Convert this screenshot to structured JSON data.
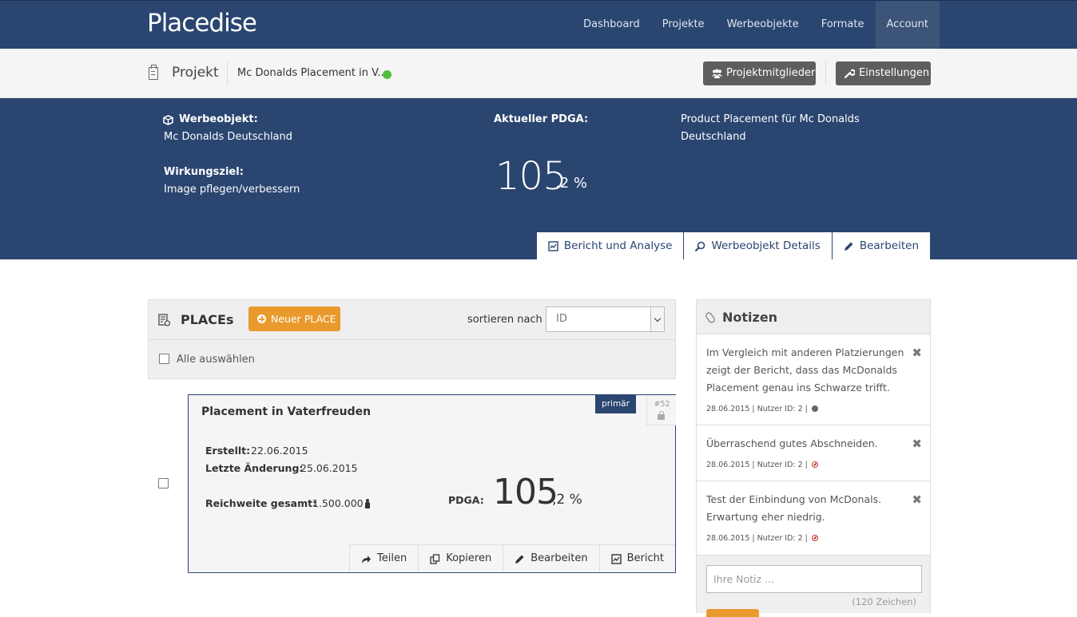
{
  "brand": "Placedise",
  "nav": {
    "items": [
      {
        "label": "Dashboard",
        "name": "nav-dashboard"
      },
      {
        "label": "Projekte",
        "name": "nav-projekte"
      },
      {
        "label": "Werbeobjekte",
        "name": "nav-werbeobjekte"
      },
      {
        "label": "Formate",
        "name": "nav-formate"
      },
      {
        "label": "Account",
        "name": "nav-account"
      }
    ],
    "active": "Account"
  },
  "project_bar": {
    "title": "Projekt",
    "name": "Mc Donalds Placement in V...",
    "status_color": "#4fbe3b",
    "members_label": "Projektmitglieder",
    "settings_label": "Einstellungen"
  },
  "summary": {
    "werbeobjekt_label": "Werbeobjekt:",
    "werbeobjekt_value": "Mc Donalds Deutschland",
    "wirkungsziel_label": "Wirkungsziel:",
    "wirkungsziel_value": "Image pflegen/verbessern",
    "pdga_label": "Aktueller PDGA:",
    "pdga_int": "105",
    "pdga_dec": ",2 %",
    "description": "Product Placement für Mc Donalds Deutschland",
    "tabs": {
      "report": "Bericht und Analyse",
      "details": "Werbeobjekt Details",
      "edit": "Bearbeiten"
    }
  },
  "places": {
    "title": "PLACEs",
    "new_label": "Neuer PLACE",
    "sort_label": "sortieren nach",
    "sort_value": "ID",
    "select_all": "Alle auswählen"
  },
  "place_card": {
    "title": "Placement in Vaterfreuden",
    "badge": "primär",
    "id": "#52",
    "created_label": "Erstellt:",
    "created_value": "22.06.2015",
    "modified_label": "Letzte Änderung:",
    "modified_value": "25.06.2015",
    "reach_label": "Reichweite gesamt:",
    "reach_value": "1.500.000",
    "pdga_label": "PDGA:",
    "pdga_int": "105",
    "pdga_dec": ",2 %",
    "actions": {
      "share": "Teilen",
      "copy": "Kopieren",
      "edit": "Bearbeiten",
      "report": "Bericht"
    }
  },
  "notes": {
    "title": "Notizen",
    "items": [
      {
        "text": "Im Vergleich mit anderen Platzierungen zeigt der Bericht, dass das McDonalds Placement genau ins Schwarze trifft.",
        "date": "28.06.2015",
        "user": "Nutzer ID: 2",
        "visibility": "public"
      },
      {
        "text": "Überraschend gutes Abschneiden.",
        "date": "28.06.2015",
        "user": "Nutzer ID: 2",
        "visibility": "private"
      },
      {
        "text": "Test der Einbindung von McDonals. Erwartung eher niedrig.",
        "date": "28.06.2015",
        "user": "Nutzer ID: 2",
        "visibility": "private"
      }
    ],
    "input_placeholder": "Ihre Notiz ...",
    "char_count": "(120 Zeichen)"
  },
  "colors": {
    "primary": "#2a4570",
    "accent": "#e99a2c",
    "status_ok": "#4fbe3b"
  }
}
